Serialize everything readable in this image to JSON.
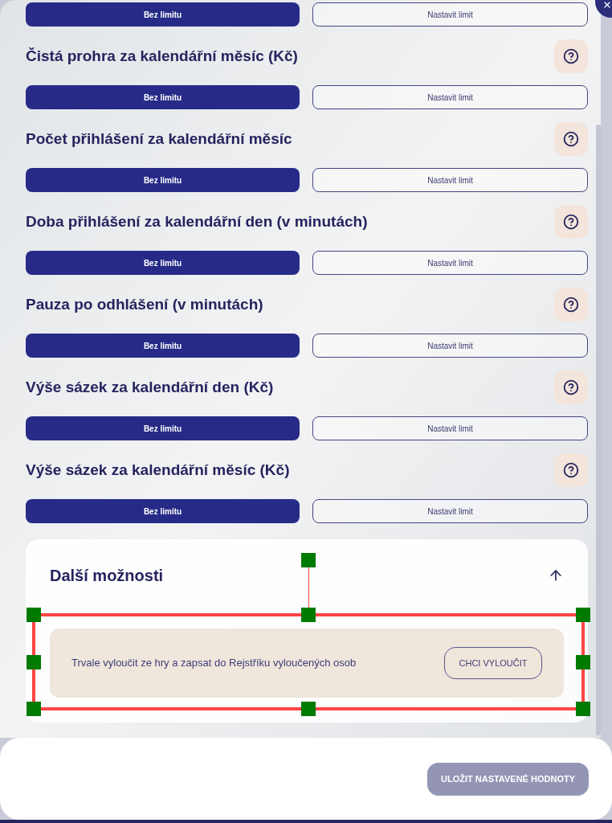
{
  "limits": [
    {
      "options": [
        {
          "label": "Bez limitu",
          "selected": true
        },
        {
          "label": "Nastavit limit",
          "selected": false
        }
      ]
    },
    {
      "title": "Čistá prohra za kalendářní měsíc (Kč)",
      "options": [
        {
          "label": "Bez limitu",
          "selected": true
        },
        {
          "label": "Nastavit limit",
          "selected": false
        }
      ]
    },
    {
      "title": "Počet přihlášení za kalendářní měsíc",
      "options": [
        {
          "label": "Bez limitu",
          "selected": true
        },
        {
          "label": "Nastavit limit",
          "selected": false
        }
      ]
    },
    {
      "title": "Doba přihlášení za kalendářní den (v minutách)",
      "options": [
        {
          "label": "Bez limitu",
          "selected": true
        },
        {
          "label": "Nastavit limit",
          "selected": false
        }
      ]
    },
    {
      "title": "Pauza po odhlášení (v minutách)",
      "options": [
        {
          "label": "Bez limitu",
          "selected": true
        },
        {
          "label": "Nastavit limit",
          "selected": false
        }
      ]
    },
    {
      "title": "Výše sázek za kalendářní den (Kč)",
      "options": [
        {
          "label": "Bez limitu",
          "selected": true
        },
        {
          "label": "Nastavit limit",
          "selected": false
        }
      ]
    },
    {
      "title": "Výše sázek za kalendářní měsíc (Kč)",
      "options": [
        {
          "label": "Bez limitu",
          "selected": true
        },
        {
          "label": "Nastavit limit",
          "selected": false
        }
      ]
    }
  ],
  "more_options": {
    "title": "Další možnosti",
    "expanded": true,
    "items": [
      {
        "text": "Trvale vyloučit ze hry a zapsat do Rejstříku vyloučených osob",
        "button": "CHCI VYLOUČIT",
        "selected": true
      }
    ]
  },
  "footer": {
    "save_button": {
      "label": "ULOŽIT NASTAVENÉ HODNOTY",
      "disabled": true
    }
  }
}
